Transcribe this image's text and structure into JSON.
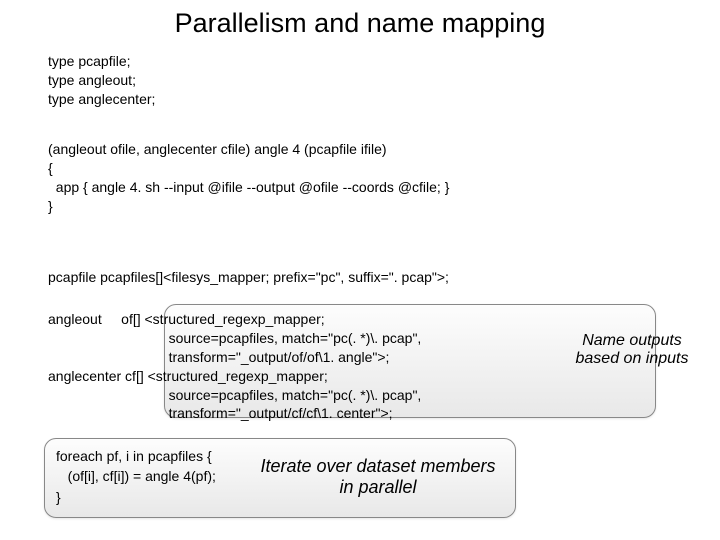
{
  "title": "Parallelism and name mapping",
  "typedecls": "type pcapfile;\ntype angleout;\ntype anglecenter;",
  "funcdecl": "(angleout ofile, anglecenter cfile) angle 4 (pcapfile ifile)\n{\n  app { angle 4. sh --input @ifile --output @ofile --coords @cfile; }\n}",
  "mapper1": "pcapfile pcapfiles[]<filesys_mapper; prefix=\"pc\", suffix=\". pcap\">;",
  "mapper2": "angleout     of[] <structured_regexp_mapper;\n                               source=pcapfiles, match=\"pc(. *)\\. pcap\",\n                               transform=\"_output/of/of\\1. angle\">;\nanglecenter cf[] <structured_regexp_mapper;\n                               source=pcapfiles, match=\"pc(. *)\\. pcap\",\n                               transform=\"_output/cf/cf\\1. center\">;",
  "sideNote": "Name outputs based on inputs",
  "foreachCode": "foreach pf, i in pcapfiles {\n   (of[i], cf[i]) = angle 4(pf);\n}",
  "iterNote": "Iterate over dataset members in parallel"
}
